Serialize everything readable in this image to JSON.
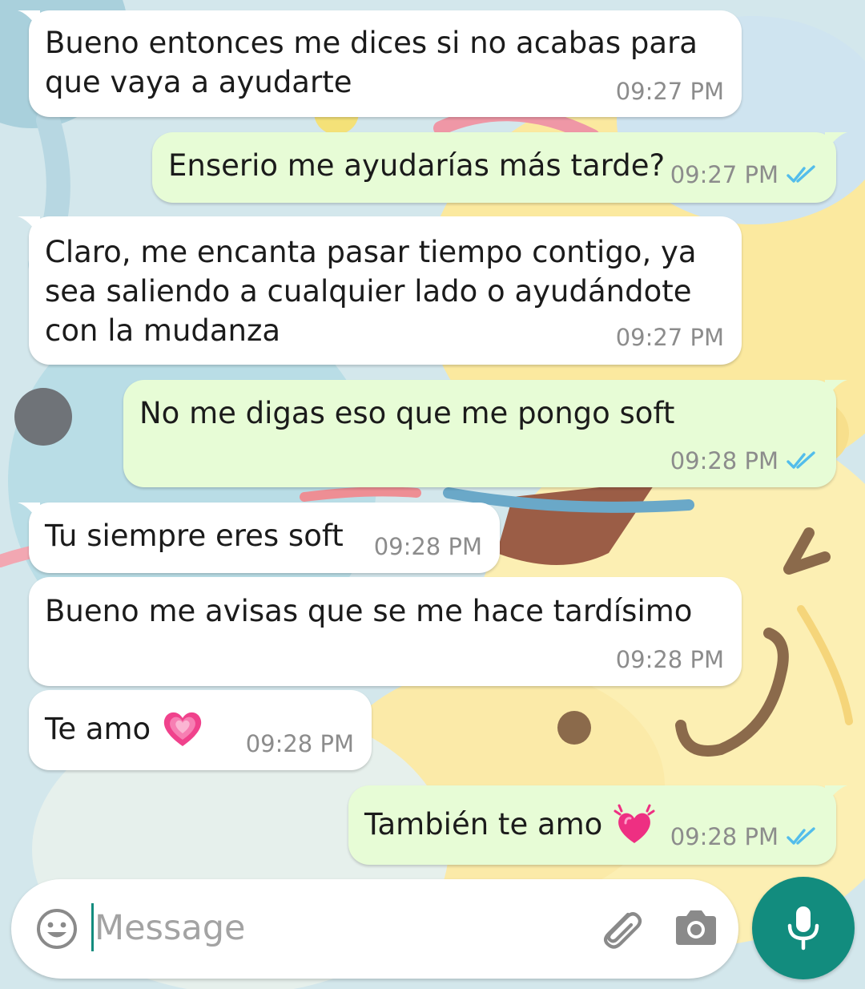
{
  "colors": {
    "incoming_bubble": "#ffffff",
    "outgoing_bubble": "#e7fcd6",
    "timestamp": "#8c8c8c",
    "read_ticks": "#53bdeb",
    "accent": "#128c7e"
  },
  "messages": [
    {
      "direction": "incoming",
      "text": "Bueno entonces me dices si no acabas para\nque vaya a ayudarte",
      "time": "09:27 PM"
    },
    {
      "direction": "outgoing",
      "text": "Enserio me ayudarías más tarde?",
      "time": "09:27 PM",
      "status": "read"
    },
    {
      "direction": "incoming",
      "text": "Claro, me encanta pasar tiempo contigo, ya\nsea saliendo a cualquier lado o ayudándote\ncon la mudanza",
      "time": "09:27 PM"
    },
    {
      "direction": "outgoing",
      "text": "No me digas eso que me pongo soft",
      "time": "09:28 PM",
      "status": "read"
    },
    {
      "direction": "incoming",
      "text": "Tu siempre eres soft",
      "time": "09:28 PM"
    },
    {
      "direction": "incoming",
      "text": "Bueno me avisas que se me hace tardísimo",
      "time": "09:28 PM"
    },
    {
      "direction": "incoming",
      "text": "Te amo",
      "emoji": "growing-heart",
      "time": "09:28 PM"
    },
    {
      "direction": "outgoing",
      "text": "También te amo",
      "emoji": "beating-heart",
      "time": "09:28 PM",
      "status": "read"
    }
  ],
  "composer": {
    "placeholder": "Message",
    "value": "",
    "icons": {
      "emoji": "emoji-smiley-icon",
      "attach": "paperclip-icon",
      "camera": "camera-icon",
      "send": "microphone-icon"
    }
  }
}
